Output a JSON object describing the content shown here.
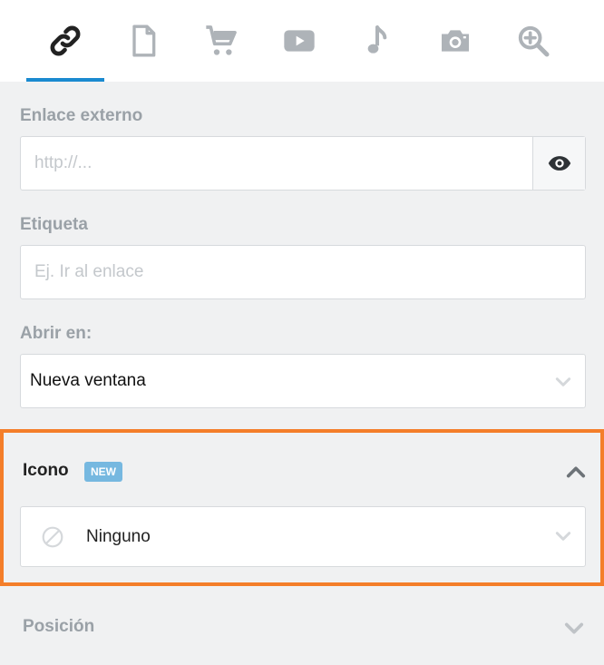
{
  "tabs": [
    {
      "icon": "link-icon",
      "active": true
    },
    {
      "icon": "document-icon",
      "active": false
    },
    {
      "icon": "cart-icon",
      "active": false
    },
    {
      "icon": "video-icon",
      "active": false
    },
    {
      "icon": "music-icon",
      "active": false
    },
    {
      "icon": "camera-icon",
      "active": false
    },
    {
      "icon": "zoom-in-icon",
      "active": false
    }
  ],
  "colors": {
    "accent": "#1a8ad0",
    "highlight_border": "#f47e2a",
    "badge": "#76b8e0",
    "muted_label": "#9aa1a7"
  },
  "external_link": {
    "label": "Enlace externo",
    "placeholder": "http://...",
    "value": "",
    "preview_icon": "eye-icon"
  },
  "tag": {
    "label": "Etiqueta",
    "placeholder": "Ej. Ir al enlace",
    "value": ""
  },
  "open_in": {
    "label": "Abrir en:",
    "value": "Nueva ventana"
  },
  "icon_section": {
    "title": "Icono",
    "badge": "NEW",
    "selected": "Ninguno",
    "selected_icon": "none-icon"
  },
  "position_section": {
    "title": "Posición"
  }
}
